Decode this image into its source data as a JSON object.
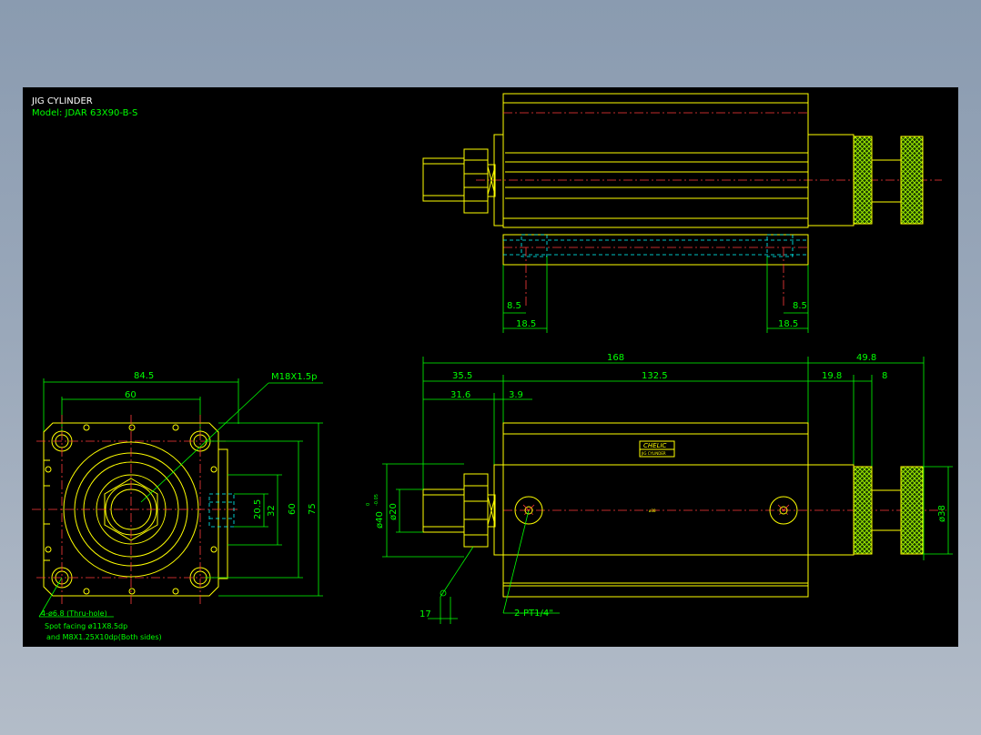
{
  "title_block": {
    "title": "JIG CYLINDER",
    "model": "Model: JDAR 63X90-B-S"
  },
  "colors": {
    "background": "#000000",
    "outline": "#ffff00",
    "dimension": "#00ff00",
    "centerline": "#ff3b3b",
    "hidden": "#00ffff",
    "text": "#ffffff"
  },
  "top_view": {
    "dims": {
      "left_inner": "8.5",
      "left_outer": "18.5",
      "right_inner": "8.5",
      "right_outer": "18.5"
    }
  },
  "front_view": {
    "dims": {
      "total": "168",
      "rear": "49.8",
      "rod_end": "35.5",
      "body": "132.5",
      "rear_a": "19.8",
      "rear_b": "8",
      "rod_len": "31.6",
      "rod_gap": "3.9",
      "rod_dia": "ø20",
      "boss_dia": "ø40",
      "tol_upper": "0",
      "tol_lower": "-0.05",
      "bore": "ø38",
      "wrench": "17"
    },
    "port_label": "2-PT1/4\"",
    "logo_text": "CHELIC",
    "logo_sub": "JIG CYLINDER"
  },
  "side_view": {
    "dims": {
      "width": "84.5",
      "pitch": "60",
      "h_inner": "20.5",
      "h_mid": "32",
      "h_pitch": "60",
      "h_total": "75"
    },
    "thread_label": "M18X1.5p",
    "note_lines": [
      "4-ø6.8  (Thru-hole)",
      "Spot facing  ø11X8.5dp",
      "and M8X1.25X10dp(Both sides)"
    ]
  }
}
